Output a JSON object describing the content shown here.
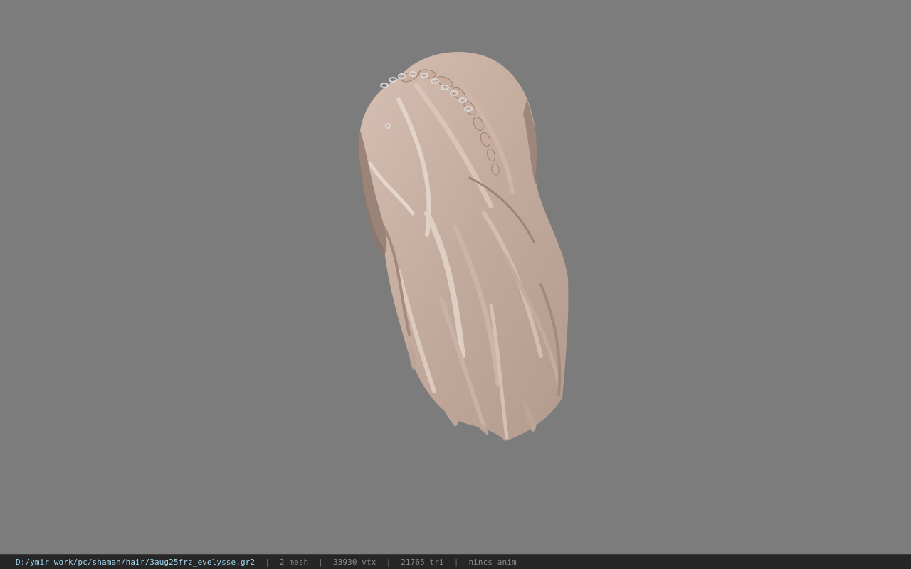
{
  "viewer": {
    "background_color": "#7c7c7c",
    "model": {
      "name": "hair model",
      "base_color": "#c9b1a3",
      "shade_color": "#8d776c",
      "accessory": "chain-headband"
    }
  },
  "statusbar": {
    "file_path": "D:/ymir work/pc/shaman/hair/3aug25frz_evelysse.gr2",
    "separator": "|",
    "mesh_count": "2 mesh",
    "vertex_count": "33930 vtx",
    "triangle_count": "21765 tri",
    "animation": "nincs anim",
    "colors": {
      "background": "#262626",
      "path": "#9fd6f0",
      "text": "#8a8a8a"
    }
  }
}
